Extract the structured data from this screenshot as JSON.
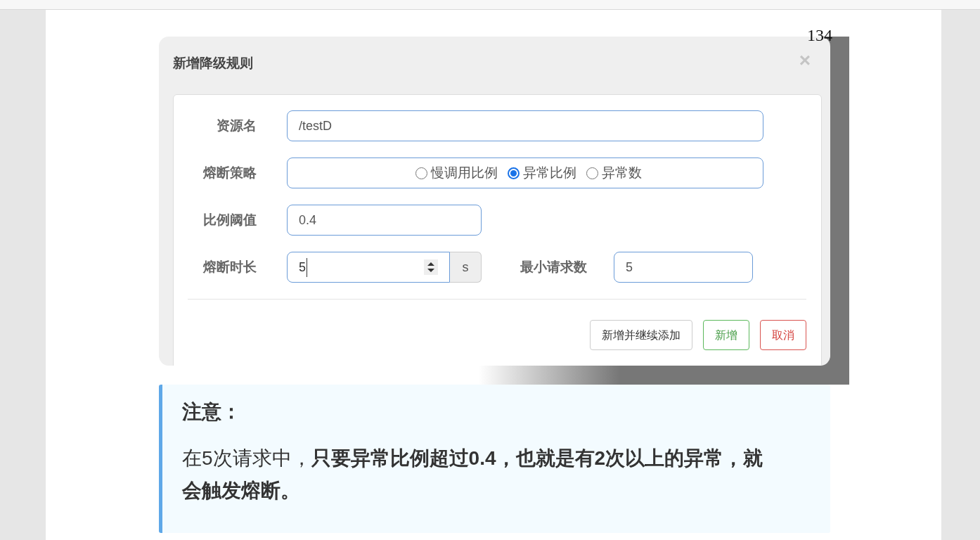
{
  "page_number": "134",
  "dialog": {
    "title": "新增降级规则",
    "close": "×",
    "fields": [
      {
        "kind": "text",
        "label": "资源名",
        "value": "/testD"
      },
      {
        "kind": "radio",
        "label": "熔断策略",
        "options": [
          {
            "label": "慢调用比例",
            "selected": false
          },
          {
            "label": "异常比例",
            "selected": true
          },
          {
            "label": "异常数",
            "selected": false
          }
        ]
      },
      {
        "kind": "short",
        "label": "比例阈值",
        "value": "0.4"
      },
      {
        "kind": "number",
        "label": "熔断时长",
        "value": "5",
        "unit": "s",
        "extra_label": "最小请求数",
        "extra_value": "5"
      }
    ],
    "buttons": [
      {
        "label": "新增并继续添加",
        "kind": "default"
      },
      {
        "label": "新增",
        "kind": "success"
      },
      {
        "label": "取消",
        "kind": "danger"
      }
    ]
  },
  "note": {
    "title": "注意：",
    "text": "在5次请求中，**只要异常比例超过0.4，也就是有2次以上的异常，就会触发熔断。**"
  }
}
